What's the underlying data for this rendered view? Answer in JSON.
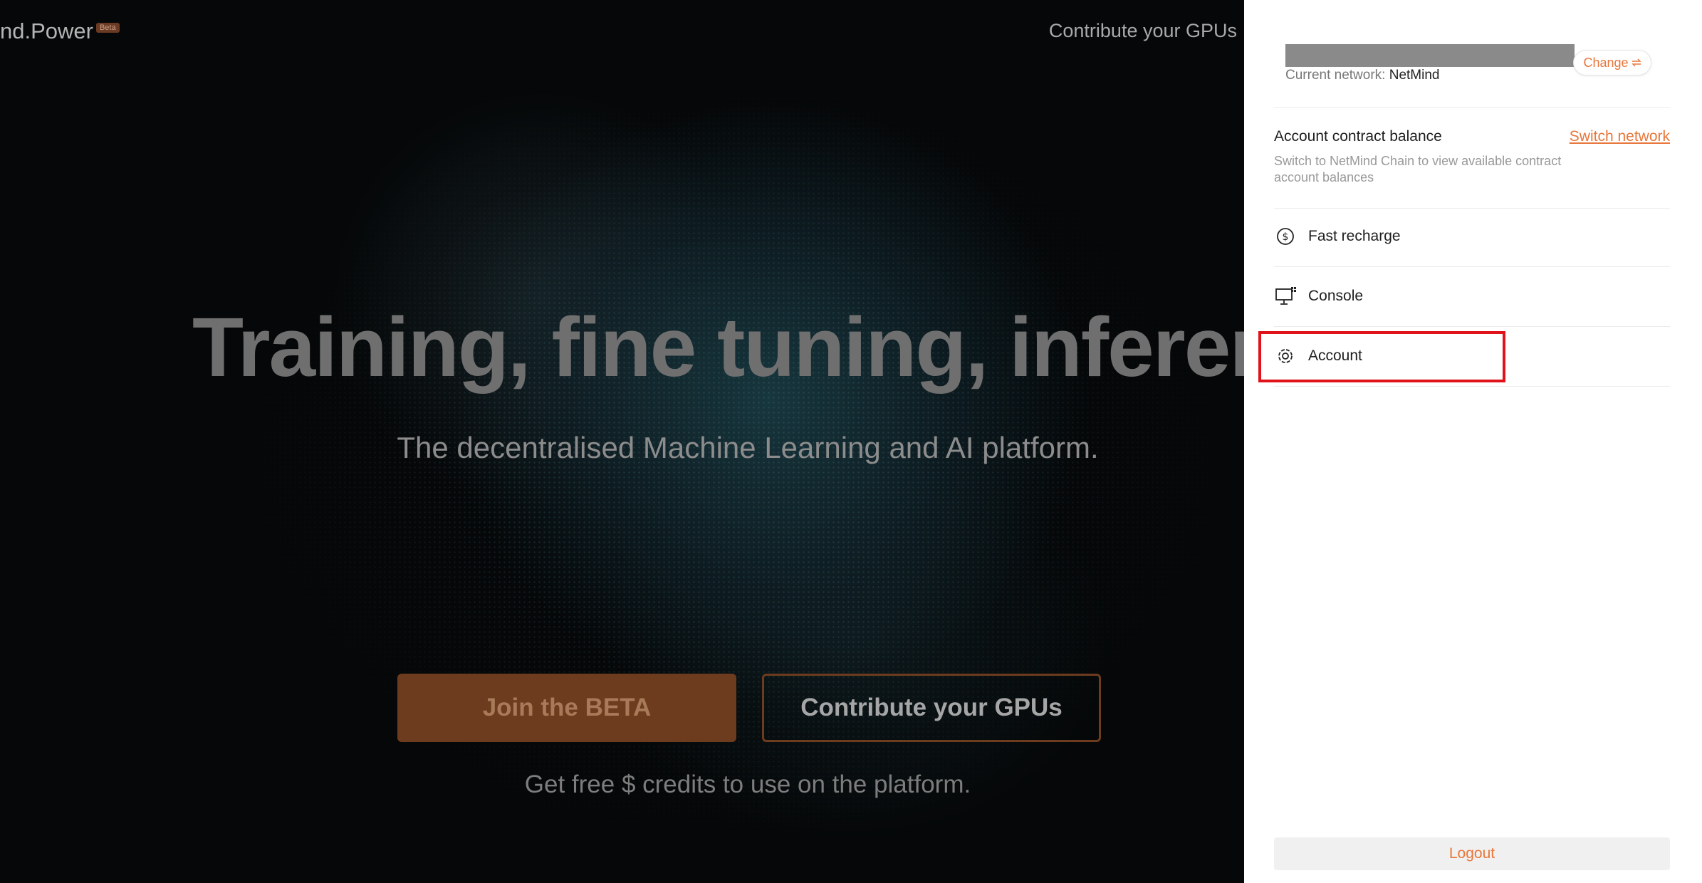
{
  "landing": {
    "brand_name": "nd.Power",
    "brand_badge": "Beta",
    "top_link": "Contribute your GPUs",
    "headline": "Training, fine tuning, inferenc",
    "subheadline": "The decentralised Machine Learning and AI platform.",
    "cta_primary": "Join the BETA",
    "cta_secondary": "Contribute your GPUs",
    "credits_text": "Get free $ credits to use on the platform."
  },
  "panel": {
    "network_label": "Current network:",
    "network_name": "NetMind",
    "change_label": "Change",
    "change_icon": "swap-icon",
    "balance_title": "Account contract balance",
    "switch_network_label": "Switch network",
    "balance_description": "Switch to NetMind Chain to view available contract account balances",
    "menu": [
      {
        "label": "Fast recharge",
        "icon": "dollar-circle-icon"
      },
      {
        "label": "Console",
        "icon": "monitor-icon"
      },
      {
        "label": "Account",
        "icon": "gear-icon"
      }
    ],
    "logout_label": "Logout"
  },
  "colors": {
    "accent": "#e8763a",
    "highlight": "#e0131b",
    "beta_button": "#6d3b1d"
  }
}
